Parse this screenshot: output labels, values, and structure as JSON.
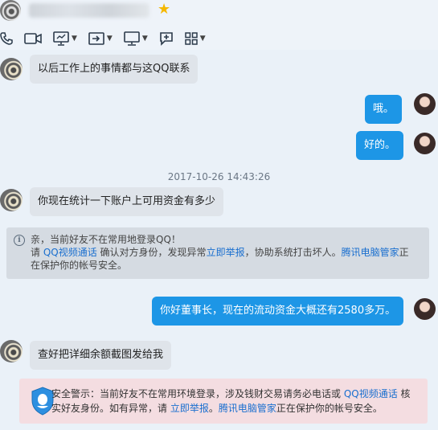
{
  "header": {
    "toolbar": [
      "phone-icon",
      "video-icon",
      "screen-share-icon",
      "transfer-icon",
      "remote-desktop-icon",
      "add-chat-icon",
      "apps-icon"
    ]
  },
  "messages": {
    "m1": "以后工作上的事情都与这QQ联系",
    "m2": "哦。",
    "m3": "好的。",
    "time": "2017-10-26 14:43:26",
    "m4": "你现在统计一下账户上可用资金有多少",
    "m5": "你好董事长，现在的流动资金大概还有2580多万。",
    "m6": "查好把详细余额截图发给我"
  },
  "notice": {
    "line1": "亲，当前好友不在常用地登录QQ！",
    "l2a": "请 ",
    "l2link1": "QQ视频通话",
    "l2b": " 确认对方身份，发现异常",
    "l2link2": "立即举报",
    "l2c": "，协助系统打击坏人。",
    "l2link3": "腾讯电脑管家",
    "l2d": "正",
    "line3": "在保护你的帐号安全。"
  },
  "warning": {
    "a": "安全警示：当前好友不在常用环境登录，涉及钱财交易请务必电话或 ",
    "link1": "QQ视频通话",
    "b": " 核",
    "c": "实好友身份。如有异常，请 ",
    "link2": "立即举报",
    "d": "。",
    "link3": "腾讯电脑管家",
    "e": "正在保护你的帐号安全。"
  },
  "colors": {
    "accent": "#1d96e6",
    "link": "#1a6fcf",
    "warning_bg": "#f4dde1"
  }
}
